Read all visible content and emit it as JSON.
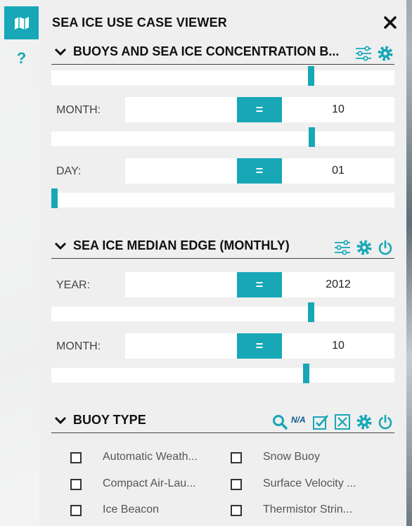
{
  "app": {
    "title": "SEA ICE USE CASE VIEWER"
  },
  "colors": {
    "accent": "#17a7b6",
    "panel": "#efefef",
    "dark_blue": "#0d5c8e"
  },
  "rail": {
    "items": [
      {
        "icon": "map-icon",
        "active": true
      },
      {
        "icon": "help-icon",
        "label": "?"
      }
    ]
  },
  "sections": {
    "buoys": {
      "title": "BUOYS AND SEA ICE CONCENTRATION B...",
      "icons": [
        "sliders-icon",
        "gear-icon"
      ],
      "fields": [
        {
          "label": "MONTH:",
          "operator": "=",
          "value": "10"
        },
        {
          "label": "DAY:",
          "operator": "=",
          "value": "01"
        }
      ]
    },
    "median_edge": {
      "title": "SEA ICE MEDIAN EDGE (MONTHLY)",
      "icons": [
        "sliders-icon",
        "gear-icon",
        "power-icon"
      ],
      "fields": [
        {
          "label": "YEAR:",
          "operator": "=",
          "value": "2012"
        },
        {
          "label": "MONTH:",
          "operator": "=",
          "value": "10"
        }
      ]
    },
    "buoy_type": {
      "title": "BUOY TYPE",
      "na_label": "N/A",
      "icons": [
        "search-icon",
        "na-icon",
        "check-all-icon",
        "clear-all-icon",
        "gear-icon",
        "power-icon"
      ],
      "options": [
        {
          "label": "Automatic Weath...",
          "checked": false
        },
        {
          "label": "Snow Buoy",
          "checked": false
        },
        {
          "label": "Compact Air-Lau...",
          "checked": false
        },
        {
          "label": "Surface Velocity ...",
          "checked": false
        },
        {
          "label": "Ice Beacon",
          "checked": false
        },
        {
          "label": "Thermistor Strin...",
          "checked": false
        }
      ]
    }
  }
}
